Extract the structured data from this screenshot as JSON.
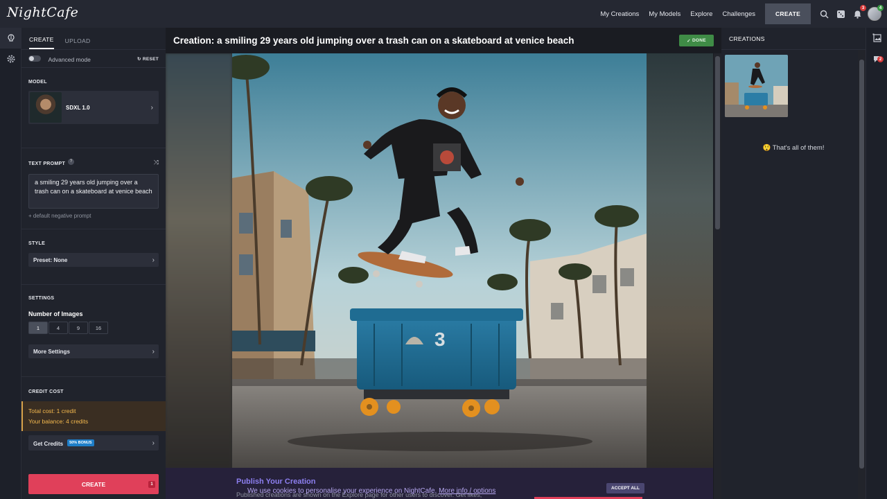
{
  "app": {
    "logo": "NightCafe"
  },
  "topnav": {
    "links": [
      "My Creations",
      "My Models",
      "Explore",
      "Challenges"
    ],
    "create_label": "CREATE",
    "notif_count": "3",
    "avatar_badge": "4"
  },
  "left": {
    "tabs": [
      "CREATE",
      "UPLOAD"
    ],
    "advanced_label": "Advanced mode",
    "reset_label": "RESET",
    "model_title": "MODEL",
    "model_name": "SDXL 1.0",
    "prompt_title": "TEXT PROMPT",
    "prompt_help": "?",
    "prompt_value": "a smiling 29 years old jumping over a trash can on a skateboard at venice beach",
    "negative_label": "+ default negative prompt",
    "style_title": "STYLE",
    "style_value": "Preset: None",
    "settings_title": "SETTINGS",
    "num_images_label": "Number of Images",
    "num_options": [
      "1",
      "4",
      "9",
      "16"
    ],
    "more_settings": "More Settings",
    "credit_title": "CREDIT COST",
    "total_cost": "Total cost: 1 credit",
    "balance": "Your balance: 4 credits",
    "get_credits": "Get Credits",
    "bonus": "50% BONUS",
    "create_label": "CREATE",
    "create_count": "1"
  },
  "center": {
    "title": "Creation: a smiling 29 years old jumping over a trash can on a skateboard at venice beach",
    "status": "DONE",
    "bin_number": "3",
    "publish_title": "Publish Your Creation",
    "publish_sub": "Published creations are shown on the Explore page for other users to discover. Get likes,",
    "cookie_text": "We use cookies to personalise your experience on NightCafe.",
    "cookie_link": "More info / options",
    "accept_label": "ACCEPT ALL"
  },
  "right": {
    "title": "CREATIONS",
    "end_text": "😲 That's all of them!",
    "comments_badge": "2"
  },
  "colors": {
    "accent": "#e0405a",
    "done": "#3f8c46",
    "cost": "#f5b94e",
    "bonus": "#1e7ec8"
  }
}
